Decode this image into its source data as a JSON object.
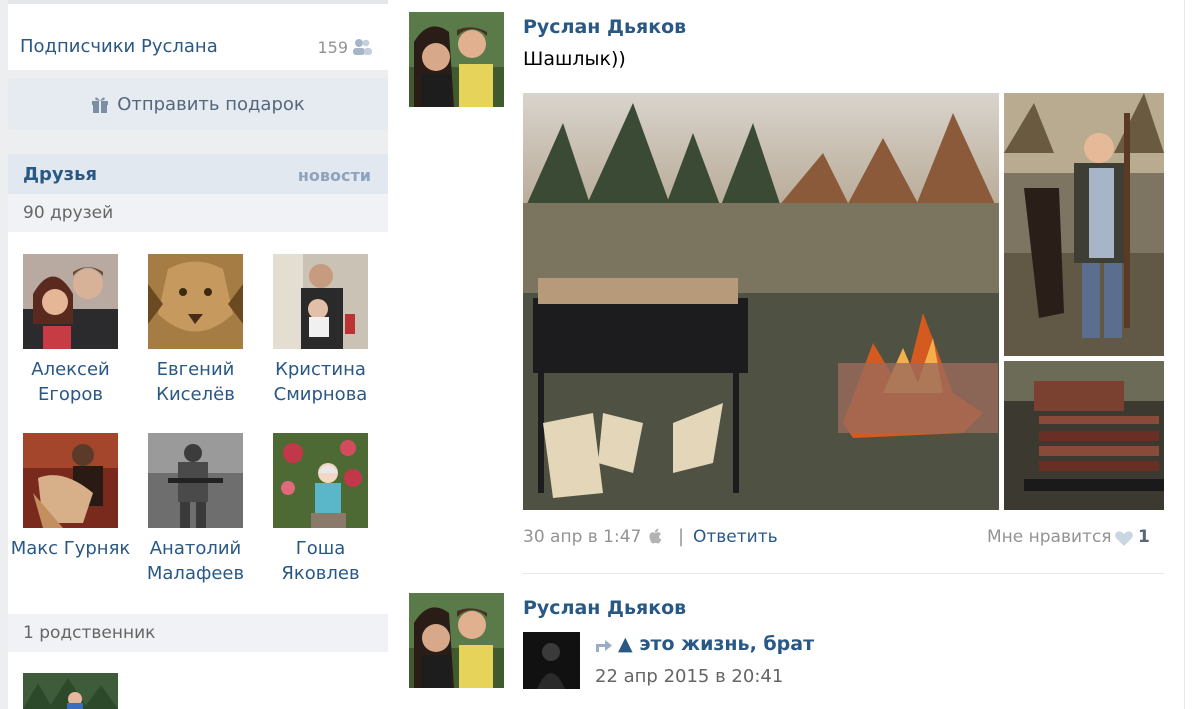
{
  "sidebar": {
    "subscribers": {
      "label": "Подписчики Руслана",
      "count": "159",
      "icon": "people-icon"
    },
    "gift_button": {
      "label": "Отправить подарок",
      "icon": "gift-icon"
    },
    "friends": {
      "title": "Друзья",
      "news_link": "новости",
      "count": "90 друзей",
      "items": [
        {
          "name": "Алексей Егоров"
        },
        {
          "name": "Евгений Киселёв"
        },
        {
          "name": "Кристина Смирнова"
        },
        {
          "name": "Макс Гурняк"
        },
        {
          "name": "Анатолий Малафеев"
        },
        {
          "name": "Гоша Яковлев"
        }
      ]
    },
    "relatives": {
      "label": "1 родственник"
    }
  },
  "feed": {
    "posts": [
      {
        "author": "Руслан Дьяков",
        "text": "Шашлык))",
        "date": "30 апр в 1:47",
        "device_icon": "apple-icon",
        "separator": "|",
        "reply_label": "Ответить",
        "like_label": "Мне нравится",
        "like_count": "1"
      },
      {
        "author": "Руслан Дьяков",
        "repost": {
          "title": "▲ это жизнь, брат",
          "date": "22 апр 2015 в 20:41"
        }
      }
    ]
  },
  "colors": {
    "link": "#2a5885",
    "muted": "#939393",
    "background": "#edeef0",
    "header_bg": "#e2e8ef"
  }
}
